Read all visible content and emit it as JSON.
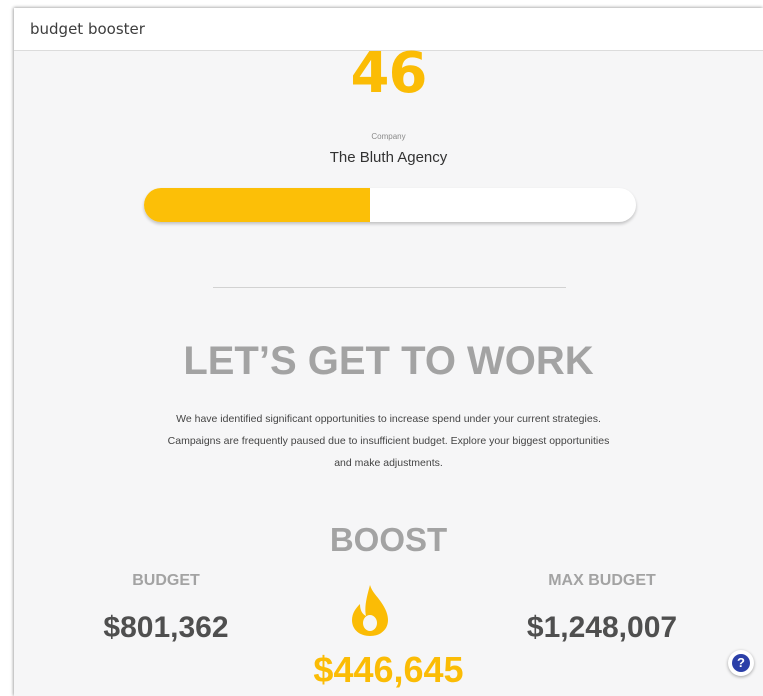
{
  "app": {
    "title": "budget booster"
  },
  "summary": {
    "score": "46",
    "company_label": "Company",
    "company_name": "The Bluth Agency",
    "progress_fraction": 0.46
  },
  "intro": {
    "headline": "LET’S GET TO WORK",
    "paragraph": "We have identified significant opportunities to increase spend under your current strategies. Campaigns are frequently paused due to insufficient budget. Explore your biggest opportunities and make adjustments."
  },
  "boost": {
    "title": "BOOST",
    "budget_label": "BUDGET",
    "budget_value": "$801,362",
    "max_budget_label": "MAX BUDGET",
    "max_budget_value": "$1,248,007",
    "boost_value": "$446,645",
    "icon": "flame-icon"
  },
  "help": {
    "icon": "help-icon",
    "glyph": "?"
  },
  "colors": {
    "accent": "#fbbc05",
    "heading_gray": "#a3a3a3",
    "value_dark": "#4f4f4f",
    "help_blue": "#2b3fa8"
  }
}
